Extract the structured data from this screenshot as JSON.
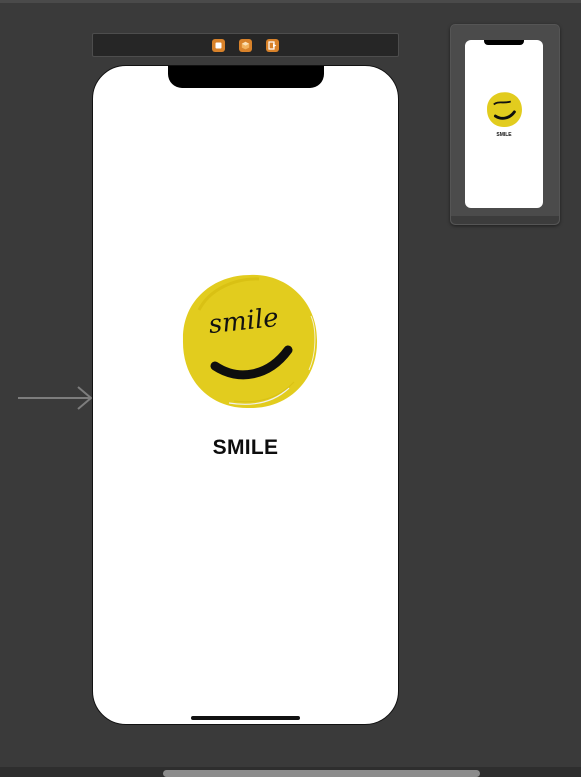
{
  "scene": {
    "dock_icons": [
      "view-controller-icon",
      "first-responder-icon",
      "exit-icon"
    ],
    "entry_point_icon": "entry-point-arrow-icon"
  },
  "screen": {
    "logo_text": "smile",
    "title": "SMILE",
    "logo_color": "#e2cc1e"
  },
  "minimap": {
    "title": "SMILE"
  },
  "colors": {
    "canvas": "#3a3a3a",
    "dock": "#262626",
    "dock_icon": "#d8822a",
    "phone_screen": "#ffffff",
    "scroll_thumb": "#8c8c8c"
  }
}
